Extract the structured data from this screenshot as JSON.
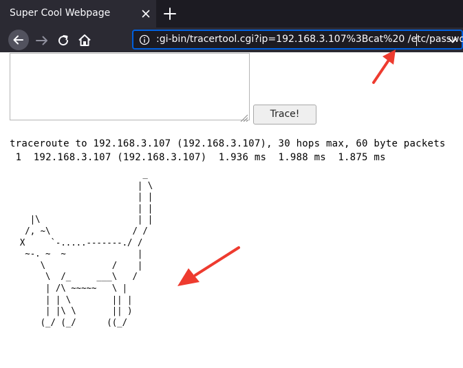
{
  "browser": {
    "tab_title": "Super Cool Webpage",
    "url_text": ":gi-bin/tracertool.cgi?ip=192.168.3.107%3Bcat%20 /etc/passwd",
    "icons": [
      "close-icon",
      "plus-icon",
      "back-arrow-icon",
      "forward-arrow-icon",
      "reload-icon",
      "home-icon",
      "info-icon",
      "chevron-down-icon"
    ],
    "colors": {
      "chrome_dark": "#1c1b22",
      "chrome": "#2b2a33",
      "url_focus": "#0060df",
      "annotation": "#ee3b2f"
    }
  },
  "form": {
    "textarea_value": "",
    "trace_button_label": "Trace!"
  },
  "output": {
    "traceroute_lines": "traceroute to 192.168.3.107 (192.168.3.107), 30 hops max, 60 byte packets\n 1  192.168.3.107 (192.168.3.107)  1.936 ms  1.988 ms  1.875 ms",
    "ascii_art": "                          _\n                         | \\\n                         | |\n                         | |\n    |\\                   | |\n   /, ~\\                / /\n  X     `-.....-------./ /\n   ~-. ~  ~              |\n      \\             /    |\n       \\  /_     ___\\   /\n       | /\\ ~~~~~   \\ |\n       | | \\        || |\n       | |\\ \\       || )\n      (_/ (_/      ((_/"
  }
}
